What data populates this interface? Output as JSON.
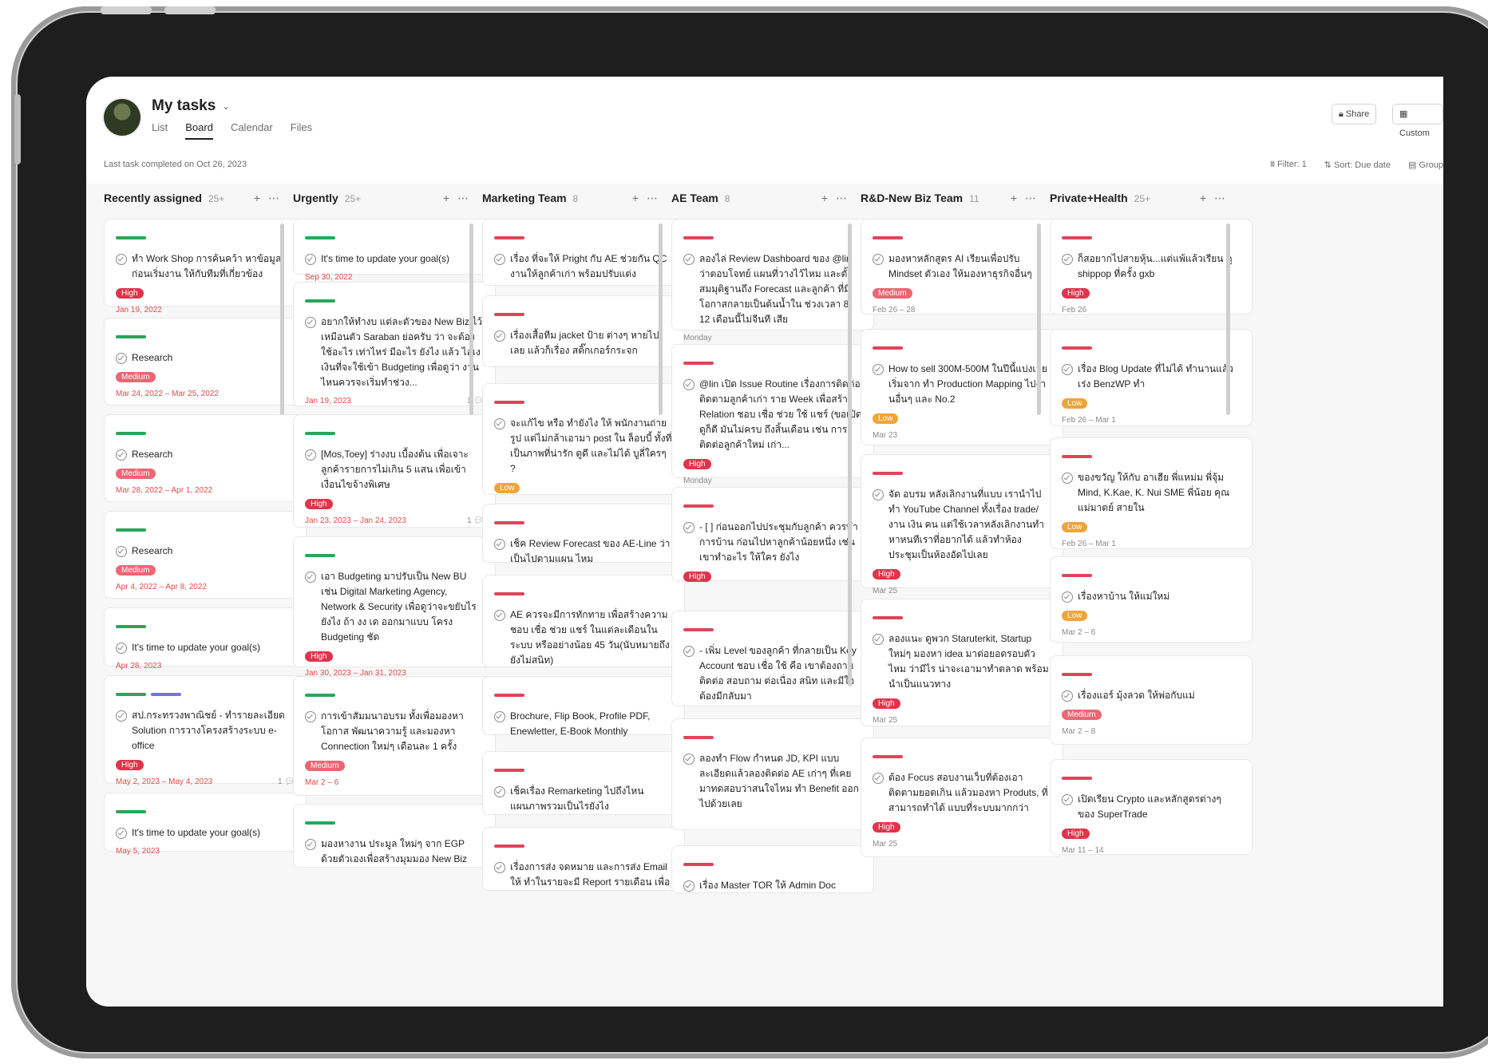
{
  "header": {
    "title": "My tasks",
    "tabs": [
      "List",
      "Board",
      "Calendar",
      "Files"
    ],
    "active_tab": "Board",
    "share_label": "Share",
    "customize_label": "Custom"
  },
  "subbar": {
    "last_completed": "Last task completed on Oct 26, 2023",
    "filter": "Filter: 1",
    "sort": "Sort: Due date",
    "group": "Group"
  },
  "columns": [
    {
      "name": "Recently assigned",
      "count": "25+",
      "cards": [
        {
          "title": "ทำ Work Shop การค้นคว้า หาข้อมูล ก่อนเริ่มงาน ให้กับทีมที่เกี่ยวข้อง",
          "tag": "High",
          "date": "Jan 19, 2022"
        },
        {
          "title": "Research",
          "tag": "Medium",
          "date": "Mar 24, 2022 – Mar 25, 2022"
        },
        {
          "title": "Research",
          "tag": "Medium",
          "date": "Mar 28, 2022 – Apr 1, 2022"
        },
        {
          "title": "Research",
          "tag": "Medium",
          "date": "Apr 4, 2022 – Apr 8, 2022"
        },
        {
          "title": "It's time to update your goal(s)",
          "date": "Apr 28, 2023"
        },
        {
          "title": "สป.กระทรวงพาณิชย์ - ทำรายละเอียด Solution การวางโครงสร้างระบบ e-office",
          "tag": "High",
          "date": "May 2, 2023 – May 4, 2023",
          "comments": "1"
        },
        {
          "title": "It's time to update your goal(s)",
          "date": "May 5, 2023"
        }
      ]
    },
    {
      "name": "Urgently",
      "count": "25+",
      "cards": [
        {
          "title": "It's time to update your goal(s)",
          "date": "Sep 30, 2022"
        },
        {
          "title": "อยากให้ทำงบ แต่ละตัวของ New Biz ไว้เหมือนตัว Saraban ย่อครับ ว่า จะต้องใช้อะไร เท่าไหร่ มีอะไร ยังไง แล้ว ไอเง เงินที่จะใช้เข้า Budgeting เพื่อดูว่า งานไหนควรจะเริ่มทำช่วง...",
          "date": "Jan 19, 2023",
          "comments": "1"
        },
        {
          "title": "[Mos,Toey] ร่างงบ เบื้องต้น เพื่อเจาะลูกค้ารายการไม่เกิน 5 แสน เพื่อเข้าเงื่อนไขจ้างพิเศษ",
          "tag": "High",
          "date": "Jan 23, 2023 – Jan 24, 2023",
          "comments": "1"
        },
        {
          "title": "เอา Budgeting มาปรับเป็น New BU เช่น Digital Marketing Agency, Network & Security เพื่อดูว่าจะขยับไรยังไง ถ้า งง เด ออกมาแบบ โครง Budgeting ชัด",
          "tag": "High",
          "date": "Jan 30, 2023 – Jan 31, 2023"
        },
        {
          "title": "การเข้าสัมมนาอบรม ทั้งเพื่อมองหาโอกาส พัฒนาความรู้ และมองหา Connection ใหม่ๆ เดือนละ 1 ครั้ง",
          "tag": "Medium",
          "date": "Mar 2 – 6"
        },
        {
          "title": "มองหางาน ประมูล ใหม่ๆ จาก EGP ด้วยตัวเองเพื่อสร้างมุมมอง New Biz"
        }
      ]
    },
    {
      "name": "Marketing Team",
      "count": "8",
      "cards": [
        {
          "title": "เรื่อง ที่จะให้ Pright กับ AE ช่วยกัน QC งานให้ลูกค้าเก่า พร้อมปรับแต่ง"
        },
        {
          "title": "เรื่องเสื้อทีม jacket ป้าย ต่างๆ หายไปเลย แล้วก็เรื่อง สติ๊กเกอร์กระจก"
        },
        {
          "title": "จะแก้ไข หรือ ทำยังไง ให้ พนักงานถ่ายรูป แต่ไม่กล้าเอามา post ใน ล็อบบี้ ทั้งที่เป็นภาพที่น่ารัก ดูดี และไม่ได้ บูลี่ใครๆ ?",
          "tag": "Low"
        },
        {
          "title": "เช็ค Review Forecast ของ AE-Line ว่าเป็นไปตามแผน ไหม"
        },
        {
          "title": "AE ควรจะมีการทักทาย เพื่อสร้างความชอบ เชื่อ ช่วย แชร์ ในแต่ละเดือนในระบบ หรืออย่างน้อย 45 วัน(นับหมายถึงยังไม่สนิท)"
        },
        {
          "title": "Brochure, Flip Book, Profile PDF, Enewletter, E-Book Monthly"
        },
        {
          "title": "เช็คเรื่อง Remarketing ไปถึงไหน แผนภาพรวมเป็นไรยังไง"
        },
        {
          "title": "เรื่องการส่ง จดหมาย และการส่ง Email ให้ ทำในรายจะมี Report รายเดือน เพื่อ"
        }
      ]
    },
    {
      "name": "AE Team",
      "count": "8",
      "cards": [
        {
          "title": "ลองไล่ Review Dashboard ของ @lin ว่าตอบโจทย์ แผนที่วางไว้ไหม และตั้งสมมุติฐานถึง Forecast และลูกค้า ที่มีโอกาสกลายเป็นต้นน้ำใน ช่วงเวลา 8-12 เดือนนี้ไม่จีนที เสีย",
          "date": "Monday"
        },
        {
          "title": "@lin เปิด Issue Routine เรื่องการติดต่อ ติดตามลูกค้าเก่า ราย Week เพื่อสร้าง Relation ชอบ เชื่อ ช่วย ใช้ แชร์ (ขอเปิดดูก็ดี มันไม่ครบ ถึงสิ้นเดือน เช่น การติดต่อลูกค้าใหม่ เก่า...",
          "tag": "High",
          "date": "Monday"
        },
        {
          "title": "- [ ] ก่อนออกไปประชุมกับลูกค้า ควรทำ การบ้าน ก่อนไปหาลูกค้าน้อยหนึ่ง เช่น เขาทำอะไร ให้ใคร ยังไง",
          "tag": "High"
        },
        {
          "title": "- เพิ่ม Level ของลูกค้า ที่กลายเป็น Key Account ชอบ เชื่อ ใช้ คือ เขาต้องถาม ติดต่อ สอบถาม ต่อเนื่อง สนิท และมีใจต้องมีกลับมา"
        },
        {
          "title": "ลองทำ Flow กำหนด JD, KPI แบบละเอียดแล้วลองติดต่อ AE เก่าๆ ที่เคยมาทดสอบว่าสนใจไหม ทำ Benefit ออกไปด้วยเลย"
        },
        {
          "title": "เรื่อง Master TOR ให้ Admin Doc"
        }
      ]
    },
    {
      "name": "R&D-New Biz Team",
      "count": "11",
      "cards": [
        {
          "title": "มองหาหลักสูตร AI เรียนเพื่อปรับ Mindset ตัวเอง ให้มองหาธุรกิจอื่นๆ",
          "tag": "Medium",
          "date": "Feb 26 – 28"
        },
        {
          "title": "How to sell 300M-500M ในปีนี้แบ่งเลย เริ่มจาก ทำ Production Mapping ไปงานอื่นๆ และ No.2",
          "tag": "Low",
          "date": "Mar 23"
        },
        {
          "title": "จัด อบรม หลังเลิกงานที่แบบ เรานำไปทำ YouTube Channel ทั้งเรื่อง trade/งาน เงิน คน แต่ใช้เวลาหลังเลิกงานทำ หาหนทีเราที่อยากได้ แล้วทำห้อง ประชุมเป็นห้องอัดไปเลย",
          "tag": "High",
          "date": "Mar 25"
        },
        {
          "title": "ลองแนะ ดูพวก Staruterkit, Startup ใหม่ๆ มองหา idea มาต่อยอดรอบตัวไหม ว่ามีไร น่าจะเอามาทำตลาด พร้อมนำเป็นแนวทาง",
          "tag": "High",
          "date": "Mar 25"
        },
        {
          "title": "ต้อง Focus สอบงานเว็บที่ต้องเอาติดตามยอดเกิน แล้วมองหา Produts, ที่สามารถทำได้ แบบที่ระบบมากกว่า",
          "tag": "High",
          "date": "Mar 25"
        }
      ]
    },
    {
      "name": "Private+Health",
      "count": "25+",
      "cards": [
        {
          "title": "ก็สอยากไปสายหุ้น...แต่แพ้แล้วเรียน ดู shippop ที่ครั้ง gxb",
          "tag": "High",
          "date": "Feb 26"
        },
        {
          "title": "เรื่อง Blog Update ที่ไม่ได้ ทำนานแล้ว เร่ง BenzWP ทำ",
          "tag": "Low",
          "date": "Feb 26 – Mar 1"
        },
        {
          "title": "ของขวัญ ให้กับ อาเฮีย พี่แหม่ม พี่จุ้ม Mind, K.Kae, K. Nui SME พี่น้อย คุณแม่มาตย์ สายใน",
          "tag": "Low",
          "date": "Feb 26 – Mar 1"
        },
        {
          "title": "เรื่องหาบ้าน ให้แม่ใหม่",
          "tag": "Low",
          "date": "Mar 2 – 6"
        },
        {
          "title": "เรื่องแอร์ มุ้งลวด ให้พ่อกับแม่",
          "tag": "Medium",
          "date": "Mar 2 – 8"
        },
        {
          "title": "เปิดเรียน Crypto และหลักสูตรต่างๆ ของ SuperTrade",
          "tag": "High",
          "date": "Mar 11 – 14"
        }
      ]
    }
  ]
}
